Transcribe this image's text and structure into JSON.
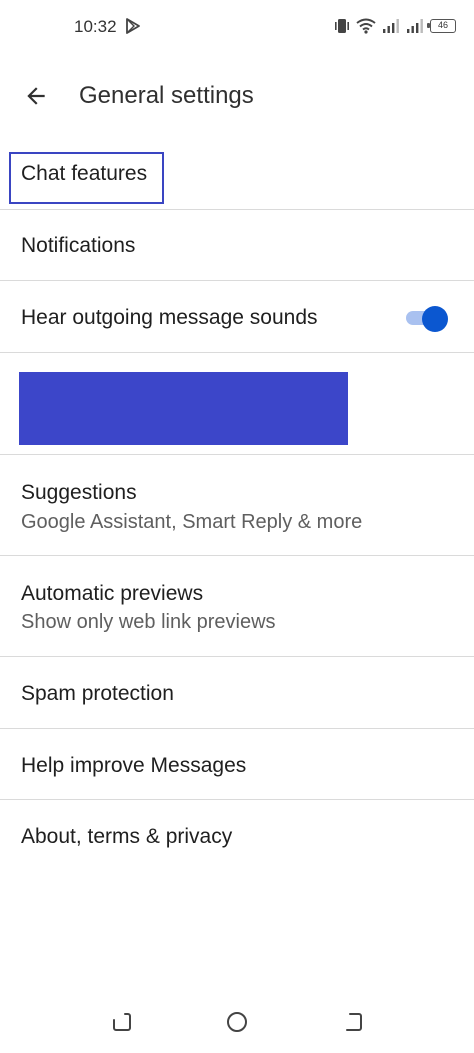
{
  "status_bar": {
    "time": "10:32",
    "battery": "46",
    "icons": [
      "play-store-icon",
      "vibrate-icon",
      "wifi-icon",
      "signal-icon",
      "signal-icon",
      "battery-icon"
    ]
  },
  "app_bar": {
    "back_icon": "arrow-back-icon",
    "title": "General settings"
  },
  "settings": {
    "chat_features": {
      "label": "Chat features"
    },
    "notifications": {
      "label": "Notifications"
    },
    "sounds": {
      "label": "Hear outgoing message sounds",
      "toggle_on": true
    },
    "suggestions": {
      "label": "Suggestions",
      "sub": "Google Assistant, Smart Reply & more"
    },
    "previews": {
      "label": "Automatic previews",
      "sub": "Show only web link previews"
    },
    "spam": {
      "label": "Spam protection"
    },
    "help": {
      "label": "Help improve Messages"
    },
    "about": {
      "label": "About, terms & privacy"
    }
  },
  "nav_bar": {
    "icons": [
      "recents-icon",
      "home-icon",
      "back-gesture-icon"
    ]
  },
  "colors": {
    "highlight_border": "#3a45c2",
    "redacted": "#3c46c9",
    "toggle_thumb": "#0b57d0",
    "toggle_track": "#a9c1f0",
    "divider": "#dadada"
  }
}
